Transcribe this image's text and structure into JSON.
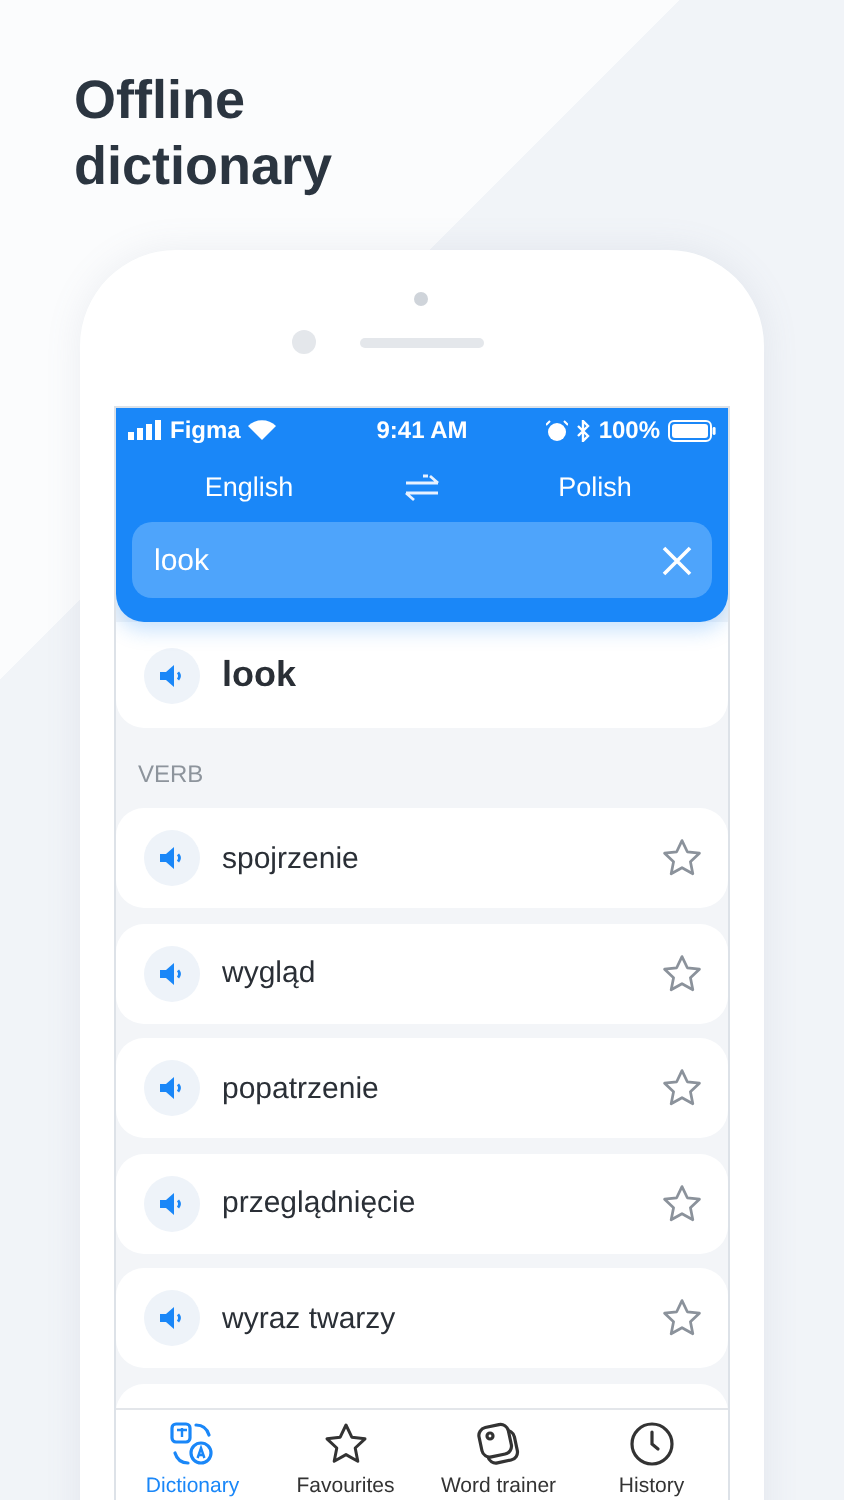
{
  "headline": "Offline dictionary",
  "status_bar": {
    "carrier": "Figma",
    "time": "9:41 AM",
    "battery": "100%"
  },
  "languages": {
    "source": "English",
    "target": "Polish"
  },
  "search": {
    "value": "look"
  },
  "entry": {
    "word": "look"
  },
  "sections": [
    {
      "heading": "VERB",
      "results": [
        {
          "text": "spojrzenie",
          "favourite": false
        },
        {
          "text": "wygląd",
          "favourite": false
        },
        {
          "text": "popatrzenie",
          "favourite": false
        },
        {
          "text": "przeglądnięcie",
          "favourite": false
        },
        {
          "text": "wyraz twarzy",
          "favourite": false
        }
      ]
    }
  ],
  "tab_bar": [
    {
      "label": "Dictionary",
      "kind": "translate",
      "selected": true
    },
    {
      "label": "Favourites",
      "kind": "star",
      "selected": false
    },
    {
      "label": "Word trainer",
      "kind": "cards",
      "selected": false
    },
    {
      "label": "History",
      "kind": "clock",
      "selected": false
    }
  ]
}
